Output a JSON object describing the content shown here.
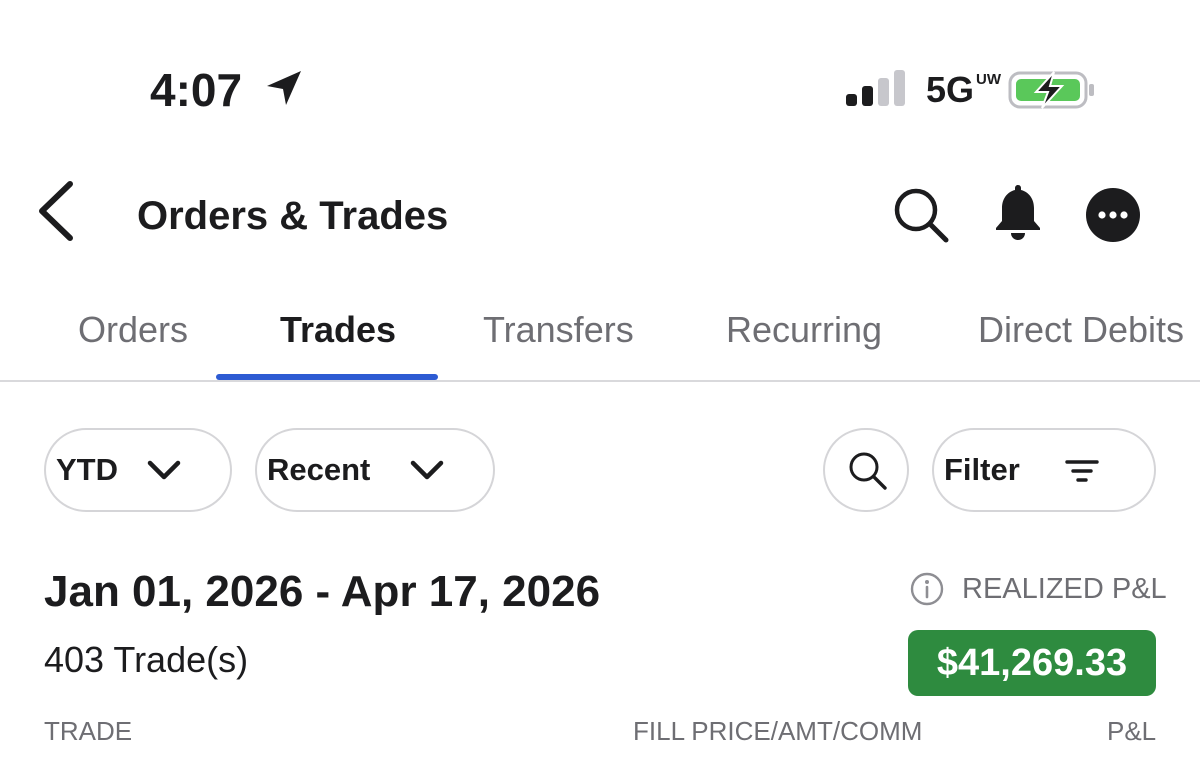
{
  "status_bar": {
    "time": "4:07",
    "network": "5G",
    "network_sup": "UW",
    "icons": [
      "location-arrow-icon",
      "signal-bars-icon",
      "battery-charging-icon"
    ]
  },
  "header": {
    "title": "Orders & Trades",
    "icons": [
      "back-chevron-icon",
      "search-icon",
      "bell-icon",
      "more-icon"
    ]
  },
  "tabs": [
    {
      "label": "Orders",
      "active": false
    },
    {
      "label": "Trades",
      "active": true
    },
    {
      "label": "Transfers",
      "active": false
    },
    {
      "label": "Recurring",
      "active": false
    },
    {
      "label": "Direct Debits",
      "active": false
    }
  ],
  "filters": {
    "period": "YTD",
    "sort": "Recent",
    "filter_label": "Filter",
    "icons": [
      "chevron-down-icon",
      "search-icon",
      "filter-lines-icon"
    ]
  },
  "summary": {
    "date_range": "Jan 01, 2026 - Apr 17, 2026",
    "trade_count": "403 Trade(s)",
    "realized_label": "REALIZED P&L",
    "realized_value": "$41,269.33",
    "positive_color": "#2e8b3f"
  },
  "columns": {
    "trade": "TRADE",
    "fill": "FILL PRICE/AMT/COMM",
    "pnl": "P&L"
  },
  "colors": {
    "accent": "#2d5bd3",
    "text": "#1c1c1e",
    "muted": "#6e6e73"
  }
}
